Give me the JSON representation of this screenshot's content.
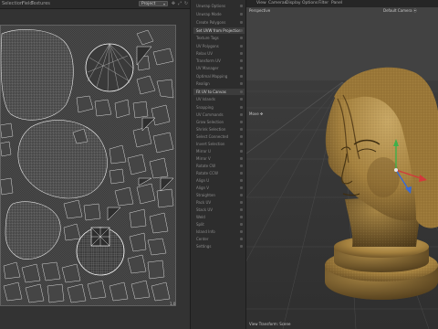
{
  "uv_editor": {
    "menus": [
      "Selection",
      "Field",
      "Textures"
    ],
    "projection_dropdown": "Project",
    "tool_icons": [
      "move-icon",
      "scale-icon",
      "rotate-icon"
    ],
    "coord_label": "1,0"
  },
  "tool_panel": {
    "items": [
      {
        "label": "Unwrap Options",
        "highlight": false
      },
      {
        "label": "Unwrap Mode",
        "highlight": false
      },
      {
        "label": "Create Polygons",
        "highlight": false
      },
      {
        "label": "Set UVW from Projection",
        "highlight": true
      },
      {
        "label": "Texture Tags",
        "highlight": false
      },
      {
        "label": "UV Polygons",
        "highlight": false
      },
      {
        "label": "Relax UV",
        "highlight": false
      },
      {
        "label": "Transform UV",
        "highlight": false
      },
      {
        "label": "UV Manager",
        "highlight": false
      },
      {
        "label": "Optimal Mapping",
        "highlight": false
      },
      {
        "label": "Realign",
        "highlight": false
      },
      {
        "label": "Fit UV to Canvas",
        "highlight": true
      },
      {
        "label": "UV Islands",
        "highlight": false
      },
      {
        "label": "Snapping",
        "highlight": false
      },
      {
        "label": "UV Commands",
        "highlight": false
      },
      {
        "label": "Grow Selection",
        "highlight": false
      },
      {
        "label": "Shrink Selection",
        "highlight": false
      },
      {
        "label": "Select Connected",
        "highlight": false
      },
      {
        "label": "Invert Selection",
        "highlight": false
      },
      {
        "label": "Mirror U",
        "highlight": false
      },
      {
        "label": "Mirror V",
        "highlight": false
      },
      {
        "label": "Rotate CW",
        "highlight": false
      },
      {
        "label": "Rotate CCW",
        "highlight": false
      },
      {
        "label": "Align U",
        "highlight": false
      },
      {
        "label": "Align V",
        "highlight": false
      },
      {
        "label": "Straighten",
        "highlight": false
      },
      {
        "label": "Pack UV",
        "highlight": false
      },
      {
        "label": "Stack UV",
        "highlight": false
      },
      {
        "label": "Weld",
        "highlight": false
      },
      {
        "label": "Split",
        "highlight": false
      },
      {
        "label": "Island Info",
        "highlight": false
      },
      {
        "label": "Center",
        "highlight": false
      },
      {
        "label": "Settings",
        "highlight": false
      }
    ]
  },
  "viewport": {
    "menus": [
      "View",
      "Cameras",
      "Display",
      "Options",
      "Filter",
      "Panel"
    ],
    "perspective_label": "Perspective",
    "camera_label": "Default Camera",
    "mode_label": "Move",
    "footer_label": "View Transform: Scene"
  },
  "colors": {
    "bust_bronze": "#b08a4a",
    "axis_y": "#3fb04a",
    "axis_x": "#d23a3a",
    "axis_z": "#3a6ad2"
  }
}
